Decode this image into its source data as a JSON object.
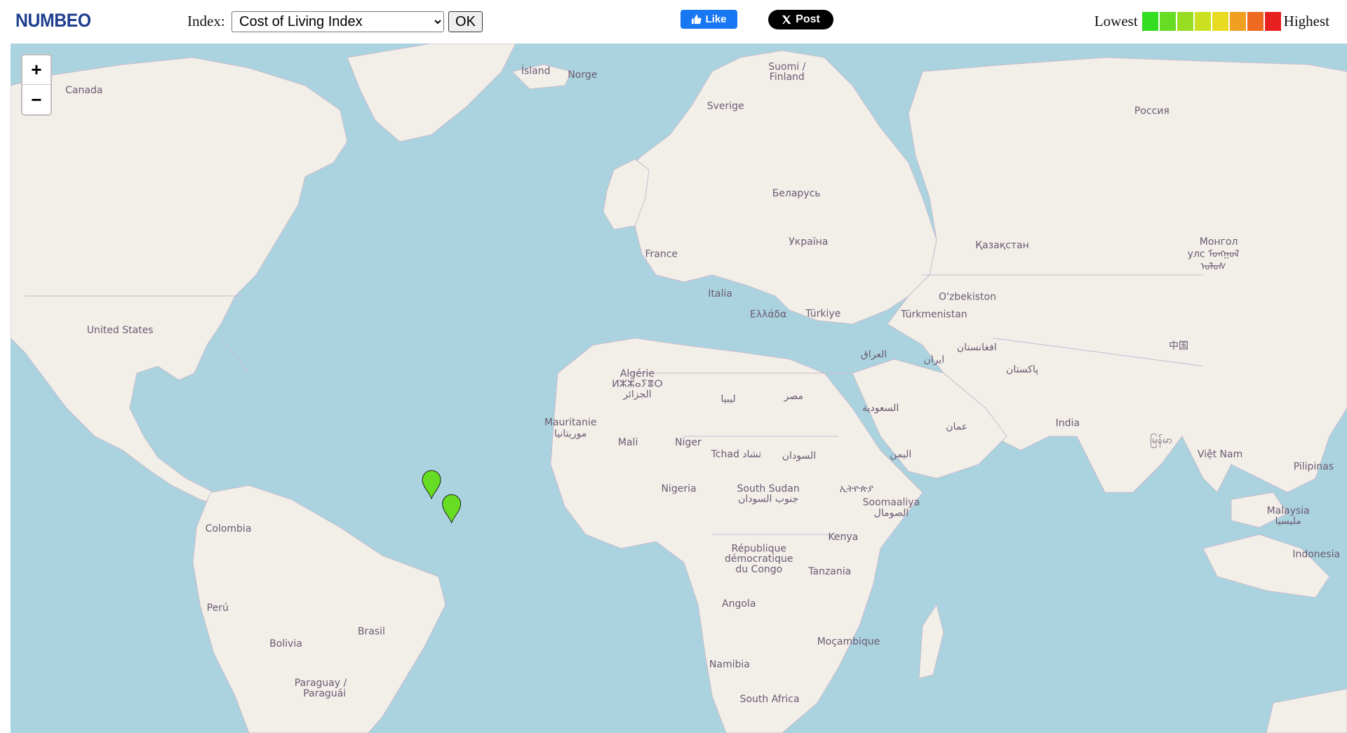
{
  "header": {
    "logo": "NUMBEO",
    "index_label": "Index:",
    "index_selected": "Cost of Living Index",
    "ok_label": "OK",
    "like_label": "Like",
    "post_label": "Post",
    "legend_low": "Lowest",
    "legend_high": "Highest",
    "legend_colors": [
      "#33dd22",
      "#66dd22",
      "#99dd22",
      "#cce022",
      "#e8dc22",
      "#f0a020",
      "#ee6a20",
      "#e82020"
    ]
  },
  "map": {
    "zoom_in": "+",
    "zoom_out": "−",
    "labels": [
      {
        "text": "Canada",
        "lx": 0.055,
        "ly": 0.072
      },
      {
        "text": "United States",
        "lx": 0.082,
        "ly": 0.42
      },
      {
        "text": "Colombia",
        "lx": 0.163,
        "ly": 0.708
      },
      {
        "text": "Perú",
        "lx": 0.155,
        "ly": 0.823
      },
      {
        "text": "Bolivia",
        "lx": 0.206,
        "ly": 0.875
      },
      {
        "text": "Brasil",
        "lx": 0.27,
        "ly": 0.857
      },
      {
        "text": "Paraguay /",
        "lx": 0.232,
        "ly": 0.932
      },
      {
        "text": "Paraguái",
        "lx": 0.235,
        "ly": 0.947
      },
      {
        "text": "Ísland",
        "lx": 0.393,
        "ly": 0.044
      },
      {
        "text": "Norge",
        "lx": 0.428,
        "ly": 0.05
      },
      {
        "text": "Suomi /",
        "lx": 0.581,
        "ly": 0.038
      },
      {
        "text": "Finland",
        "lx": 0.581,
        "ly": 0.053
      },
      {
        "text": "Sverige",
        "lx": 0.535,
        "ly": 0.095
      },
      {
        "text": "Беларусь",
        "lx": 0.588,
        "ly": 0.222
      },
      {
        "text": "Україна",
        "lx": 0.597,
        "ly": 0.292
      },
      {
        "text": "France",
        "lx": 0.487,
        "ly": 0.31
      },
      {
        "text": "Italia",
        "lx": 0.531,
        "ly": 0.367
      },
      {
        "text": "Ελλάδα",
        "lx": 0.567,
        "ly": 0.397
      },
      {
        "text": "Türkiye",
        "lx": 0.608,
        "ly": 0.396
      },
      {
        "text": "Algérie",
        "lx": 0.469,
        "ly": 0.483
      },
      {
        "text": "ⵍⵣⵣⴰⵢⴻⵔ",
        "lx": 0.469,
        "ly": 0.498
      },
      {
        "text": "الجزائر",
        "lx": 0.469,
        "ly": 0.513
      },
      {
        "text": "ليبيا",
        "lx": 0.537,
        "ly": 0.52
      },
      {
        "text": "مصر",
        "lx": 0.586,
        "ly": 0.516
      },
      {
        "text": "Mauritanie",
        "lx": 0.419,
        "ly": 0.554
      },
      {
        "text": "موريتانيا",
        "lx": 0.419,
        "ly": 0.57
      },
      {
        "text": "Mali",
        "lx": 0.462,
        "ly": 0.583
      },
      {
        "text": "Niger",
        "lx": 0.507,
        "ly": 0.583
      },
      {
        "text": "Tchad تشاد",
        "lx": 0.543,
        "ly": 0.6
      },
      {
        "text": "السودان",
        "lx": 0.59,
        "ly": 0.602
      },
      {
        "text": "Nigeria",
        "lx": 0.5,
        "ly": 0.65
      },
      {
        "text": "South Sudan",
        "lx": 0.567,
        "ly": 0.65
      },
      {
        "text": "جنوب السودان",
        "lx": 0.567,
        "ly": 0.665
      },
      {
        "text": "ኢትዮጵያ",
        "lx": 0.633,
        "ly": 0.65
      },
      {
        "text": "Soomaaliya",
        "lx": 0.659,
        "ly": 0.67
      },
      {
        "text": "الصومال",
        "lx": 0.659,
        "ly": 0.685
      },
      {
        "text": "Kenya",
        "lx": 0.623,
        "ly": 0.72
      },
      {
        "text": "République",
        "lx": 0.56,
        "ly": 0.737
      },
      {
        "text": "démocratique",
        "lx": 0.56,
        "ly": 0.752
      },
      {
        "text": "du Congo",
        "lx": 0.56,
        "ly": 0.767
      },
      {
        "text": "Tanzania",
        "lx": 0.613,
        "ly": 0.77
      },
      {
        "text": "Angola",
        "lx": 0.545,
        "ly": 0.817
      },
      {
        "text": "Moçambique",
        "lx": 0.627,
        "ly": 0.872
      },
      {
        "text": "Namibia",
        "lx": 0.538,
        "ly": 0.905
      },
      {
        "text": "South Africa",
        "lx": 0.568,
        "ly": 0.955
      },
      {
        "text": "Россия",
        "lx": 0.854,
        "ly": 0.102
      },
      {
        "text": "Қазақстан",
        "lx": 0.742,
        "ly": 0.297
      },
      {
        "text": "O'zbekiston",
        "lx": 0.716,
        "ly": 0.372
      },
      {
        "text": "Türkmenistan",
        "lx": 0.691,
        "ly": 0.397
      },
      {
        "text": "العراق",
        "lx": 0.646,
        "ly": 0.455
      },
      {
        "text": "ایران",
        "lx": 0.691,
        "ly": 0.463
      },
      {
        "text": "افغانستان",
        "lx": 0.723,
        "ly": 0.445
      },
      {
        "text": "پاکستان",
        "lx": 0.757,
        "ly": 0.477
      },
      {
        "text": "السعودية",
        "lx": 0.651,
        "ly": 0.533
      },
      {
        "text": "عمان",
        "lx": 0.708,
        "ly": 0.56
      },
      {
        "text": "اليمن",
        "lx": 0.666,
        "ly": 0.6
      },
      {
        "text": "India",
        "lx": 0.791,
        "ly": 0.555
      },
      {
        "text": "Монгол",
        "lx": 0.904,
        "ly": 0.292
      },
      {
        "text": "улс ᠮᠣᠩᠭᠣᠯ",
        "lx": 0.9,
        "ly": 0.31
      },
      {
        "text": "ᠤᠯᠤᠰ",
        "lx": 0.9,
        "ly": 0.328
      },
      {
        "text": "中国",
        "lx": 0.874,
        "ly": 0.443
      },
      {
        "text": "မြန်မာ",
        "lx": 0.861,
        "ly": 0.58
      },
      {
        "text": "Việt Nam",
        "lx": 0.905,
        "ly": 0.6
      },
      {
        "text": "Pilipinas",
        "lx": 0.975,
        "ly": 0.618
      },
      {
        "text": "Malaysia",
        "lx": 0.956,
        "ly": 0.682
      },
      {
        "text": "مليسيا",
        "lx": 0.956,
        "ly": 0.697
      },
      {
        "text": "Indonesia",
        "lx": 0.977,
        "ly": 0.745
      }
    ],
    "markers": [
      {
        "lx": 0.315,
        "ly": 0.66,
        "c": 1
      },
      {
        "lx": 0.33,
        "ly": 0.695,
        "c": 1
      }
    ]
  }
}
